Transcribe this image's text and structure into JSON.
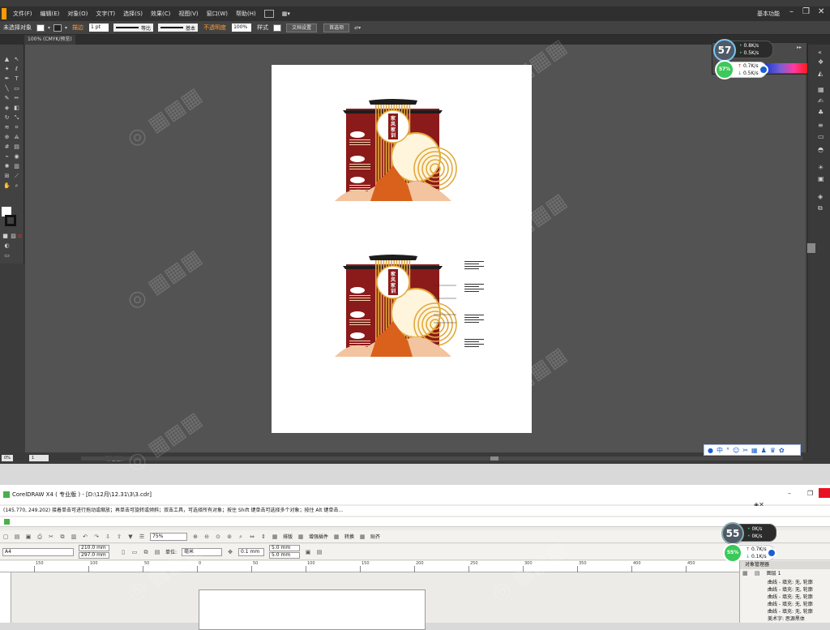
{
  "illustrator": {
    "menus": [
      "文件(F)",
      "编辑(E)",
      "对象(O)",
      "文字(T)",
      "选择(S)",
      "效果(C)",
      "视图(V)",
      "窗口(W)",
      "帮助(H)"
    ],
    "workspace": "基本功能",
    "control_bar": {
      "no_selection": "未选择对象",
      "stroke_label": "描边",
      "stroke_weight": "1 pt",
      "stroke_profile": "等比",
      "brush": "基本",
      "opacity_label": "不透明度",
      "opacity": "100%",
      "style_label": "样式",
      "doc_setup": "文档设置",
      "preferences": "首选项"
    },
    "doc_tab": "100% (CMYK/预览)",
    "status": {
      "zoom": "0%",
      "page": "1",
      "label": "编组选择"
    },
    "artwork": {
      "title_chars": [
        "家",
        "风",
        "家",
        "训"
      ],
      "colors": {
        "red": "#8b1a1a",
        "gold": "#e2a93a",
        "orange": "#d9611c",
        "peach": "#f2c4a0",
        "dark": "#1d1d1d"
      }
    }
  },
  "speed_widgets": [
    {
      "pct_big": "57",
      "pct_small": "57%",
      "up": "0.8",
      "up_unit": "K/s",
      "down": "0.5",
      "down_unit": "K/s",
      "up2": "0.7K/s",
      "down2": "0.5K/s"
    },
    {
      "pct_big": "55",
      "pct_small": "55%",
      "up": "0",
      "up_unit": "K/s",
      "down": "0",
      "down_unit": "K/s",
      "up2": "0.7K/s",
      "down2": "0.1K/s"
    }
  ],
  "ime_bar": [
    "中",
    "°",
    "☺",
    "✂",
    "▦",
    "♟",
    "♛",
    "✿"
  ],
  "coreldraw": {
    "title": "CorelDRAW X4 ( 专业版 ) - [D:\\12月\\12.31\\3\\3.cdr]",
    "hint": "(145.770, 249.202)   接着单击可进行拖动或缩放；再单击可旋转或倾斜；双击工具，可选择所有对象；按住 Shift 键单击可选择多个对象；按住 Alt 键单击...",
    "toolbar": {
      "zoom": "75%",
      "arrange": "排版",
      "plugins": "增强插件",
      "convert": "转换",
      "paste": "贴齐"
    },
    "property_bar": {
      "paper": "A4",
      "width": "210.0 mm",
      "height": "297.0 mm",
      "units_label": "单位:",
      "units": "毫米",
      "nudge": "0.1 mm",
      "dup_x": "5.0 mm",
      "dup_y": "5.0 mm"
    },
    "ruler_ticks": [
      "150",
      "100",
      "50",
      "0",
      "50",
      "100",
      "150",
      "200",
      "250",
      "300",
      "350",
      "400",
      "450"
    ],
    "docker": {
      "title": "对象管理器",
      "page_label": "图层 1",
      "items": [
        "曲线 - 填充: 无, 轮廓",
        "曲线 - 填充: 无, 轮廓",
        "曲线 - 填充: 无, 轮廓",
        "曲线 - 填充: 无, 轮廓",
        "曲线 - 填充: 无, 轮廓",
        "美术字: 思源黑体"
      ]
    }
  }
}
